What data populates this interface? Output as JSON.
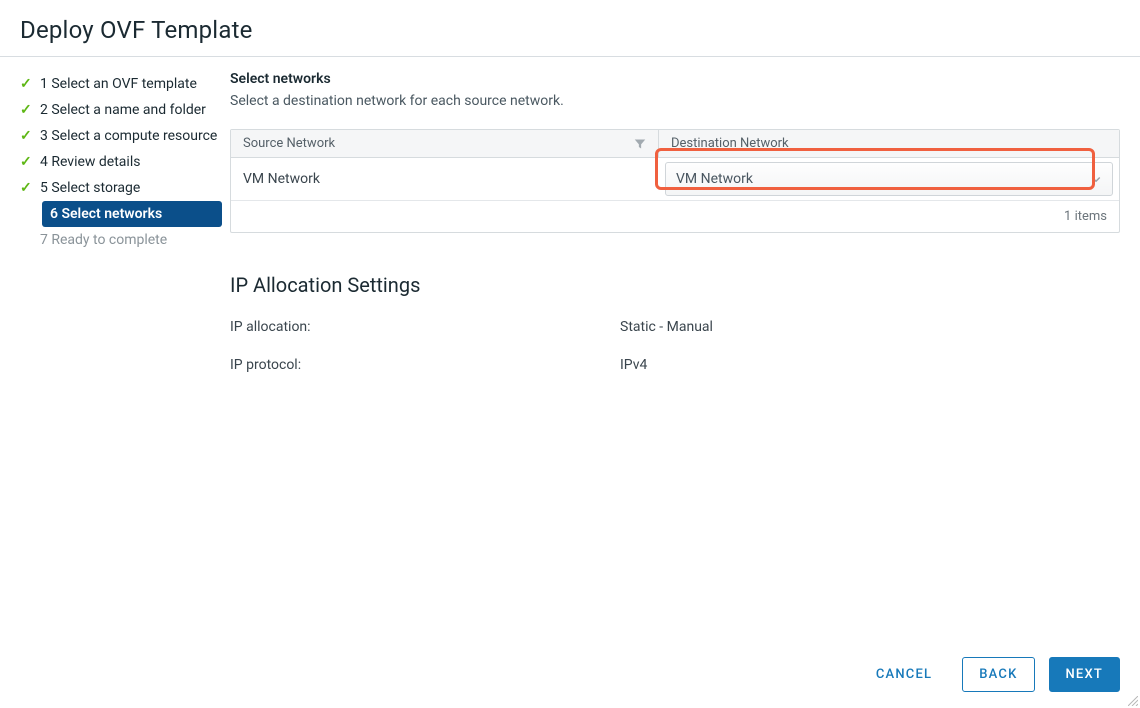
{
  "title": "Deploy OVF Template",
  "steps": [
    {
      "label": "1 Select an OVF template",
      "state": "done"
    },
    {
      "label": "2 Select a name and folder",
      "state": "done"
    },
    {
      "label": "3 Select a compute resource",
      "state": "done"
    },
    {
      "label": "4 Review details",
      "state": "done"
    },
    {
      "label": "5 Select storage",
      "state": "done"
    },
    {
      "label": "6 Select networks",
      "state": "active"
    },
    {
      "label": "7 Ready to complete",
      "state": "pending"
    }
  ],
  "content": {
    "heading": "Select networks",
    "subheading": "Select a destination network for each source network.",
    "table": {
      "header_source": "Source Network",
      "header_dest": "Destination Network",
      "rows": [
        {
          "source": "VM Network",
          "destination": "VM Network"
        }
      ],
      "footer": "1 items"
    },
    "ip_section": {
      "title": "IP Allocation Settings",
      "rows": [
        {
          "key": "IP allocation:",
          "value": "Static - Manual"
        },
        {
          "key": "IP protocol:",
          "value": "IPv4"
        }
      ]
    }
  },
  "footer": {
    "cancel": "CANCEL",
    "back": "BACK",
    "next": "NEXT"
  }
}
